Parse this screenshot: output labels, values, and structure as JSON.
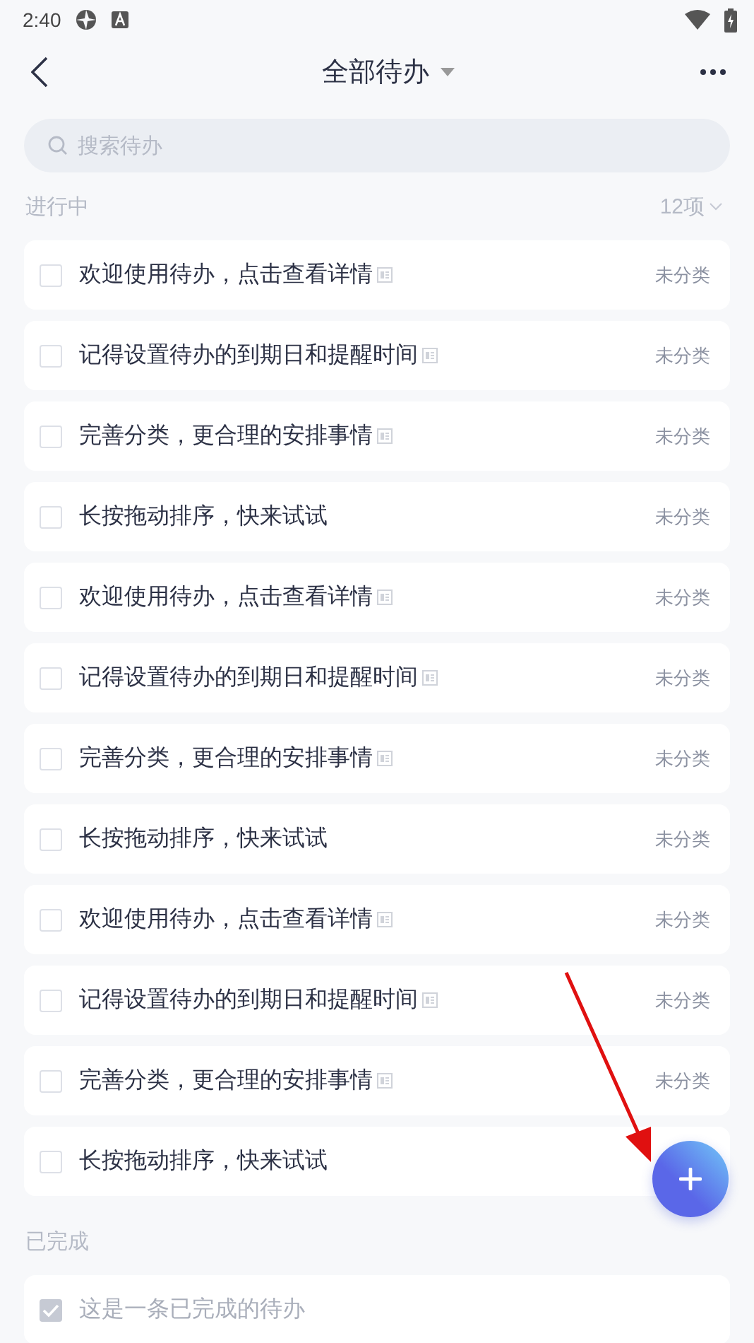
{
  "status_bar": {
    "time": "2:40"
  },
  "header": {
    "title": "全部待办"
  },
  "search": {
    "placeholder": "搜索待办"
  },
  "sections": [
    {
      "title": "进行中",
      "count": "12项",
      "items": [
        {
          "title": "欢迎使用待办，点击查看详情",
          "has_note": true,
          "category": "未分类",
          "checked": false
        },
        {
          "title": "记得设置待办的到期日和提醒时间",
          "has_note": true,
          "category": "未分类",
          "checked": false
        },
        {
          "title": "完善分类，更合理的安排事情",
          "has_note": true,
          "category": "未分类",
          "checked": false
        },
        {
          "title": "长按拖动排序，快来试试",
          "has_note": false,
          "category": "未分类",
          "checked": false
        },
        {
          "title": "欢迎使用待办，点击查看详情",
          "has_note": true,
          "category": "未分类",
          "checked": false
        },
        {
          "title": "记得设置待办的到期日和提醒时间",
          "has_note": true,
          "category": "未分类",
          "checked": false
        },
        {
          "title": "完善分类，更合理的安排事情",
          "has_note": true,
          "category": "未分类",
          "checked": false
        },
        {
          "title": "长按拖动排序，快来试试",
          "has_note": false,
          "category": "未分类",
          "checked": false
        },
        {
          "title": "欢迎使用待办，点击查看详情",
          "has_note": true,
          "category": "未分类",
          "checked": false
        },
        {
          "title": "记得设置待办的到期日和提醒时间",
          "has_note": true,
          "category": "未分类",
          "checked": false
        },
        {
          "title": "完善分类，更合理的安排事情",
          "has_note": true,
          "category": "未分类",
          "checked": false
        },
        {
          "title": "长按拖动排序，快来试试",
          "has_note": false,
          "checked": false
        }
      ]
    },
    {
      "title": "已完成",
      "items": [
        {
          "title": "这是一条已完成的待办",
          "has_note": false,
          "checked": true
        }
      ]
    }
  ]
}
